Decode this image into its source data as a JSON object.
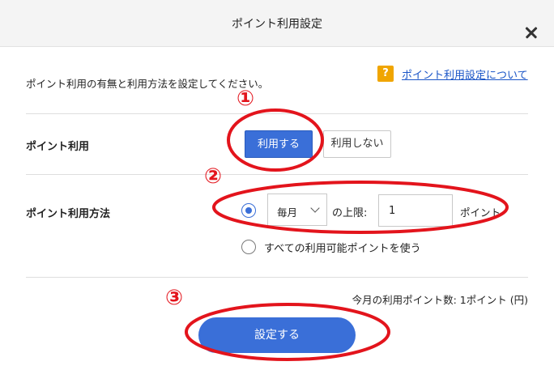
{
  "dialog": {
    "title": "ポイント利用設定",
    "description": "ポイント利用の有無と利用方法を設定してください。",
    "help_badge": "?",
    "help_link": "ポイント利用設定について"
  },
  "usage": {
    "label": "ポイント利用",
    "on_label": "利用する",
    "off_label": "利用しない",
    "selected": "利用する"
  },
  "method": {
    "label": "ポイント利用方法",
    "frequency": "毎月",
    "limit_label": "の上限:",
    "limit_value": "1",
    "unit": "ポイント",
    "all_label": "すべての利用可能ポイントを使う",
    "selected": "limit"
  },
  "summary": {
    "month_points": "今月の利用ポイント数: 1ポイント (円)"
  },
  "submit_label": "設定する",
  "annotations": {
    "marker_color": "#e3141c",
    "steps": [
      "①",
      "②",
      "③"
    ]
  },
  "colors": {
    "primary": "#3a6fd8",
    "help_badge": "#f0a500",
    "link": "#1a55c7"
  }
}
